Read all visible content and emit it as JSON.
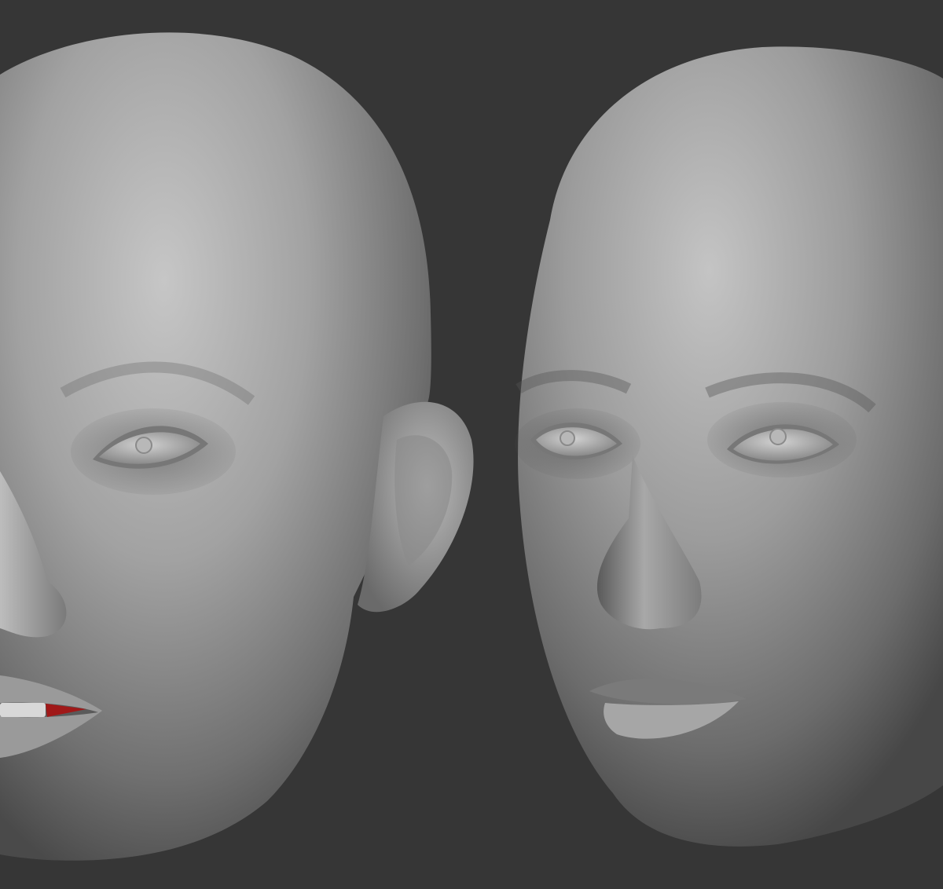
{
  "scene": {
    "background_color": "#363636",
    "subjects": [
      {
        "name": "left-head",
        "view": "three-quarter",
        "visible_features": [
          "eye",
          "ear",
          "nose",
          "mouth",
          "teeth"
        ]
      },
      {
        "name": "right-head",
        "view": "front",
        "visible_features": [
          "eyes",
          "nose",
          "mouth"
        ]
      }
    ],
    "colors": {
      "clay_light": "#c4c4c4",
      "clay_mid": "#8f8f8f",
      "clay_dark": "#4a4a4a",
      "gum_accent": "#a01818"
    }
  }
}
